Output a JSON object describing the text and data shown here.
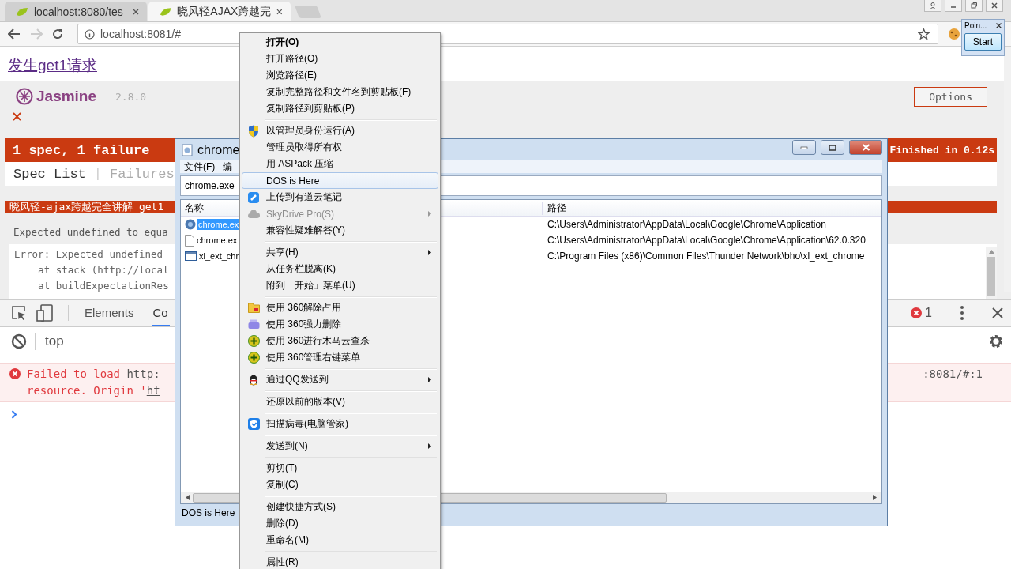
{
  "browser": {
    "tabs": [
      {
        "title": "localhost:8080/tes",
        "selected": false
      },
      {
        "title": "晓风轻AJAX跨越完",
        "selected": true
      }
    ],
    "address": "localhost:8081/#"
  },
  "page": {
    "link": "发生get1请求",
    "jasmine": {
      "logo": "Jasmine",
      "version": "2.8.0",
      "options_button": "Options",
      "summary": "1 spec, 1 failure",
      "duration": "Finished in 0.12s",
      "nav": [
        {
          "label": "Spec List",
          "selected": true
        },
        {
          "label": "Failures",
          "selected": false
        }
      ],
      "nav_separator": "|",
      "spec_title": "晓风轻-ajax跨越完全讲解 get1",
      "message": "Expected undefined to equa",
      "stack": [
        "Error: Expected undefined",
        "    at stack (http://local",
        "    at buildExpectationRes"
      ]
    }
  },
  "devtools": {
    "tabs": [
      {
        "label": "Elements",
        "selected": false
      },
      {
        "label": "Co",
        "selected": true
      }
    ],
    "error_count": "1",
    "context": "top",
    "error": {
      "lines": [
        {
          "text": "Failed to load ",
          "link": "http:"
        },
        {
          "text": "resource. Origin '",
          "link": "ht"
        }
      ],
      "source": ":8081/#:1"
    }
  },
  "explorer": {
    "title": "chrome",
    "menu": [
      "文件(F)",
      "编"
    ],
    "search": "chrome.exe",
    "columns": [
      "名称",
      "路径"
    ],
    "rows": [
      {
        "name": "chrome.ex",
        "path": "C:\\Users\\Administrator\\AppData\\Local\\Google\\Chrome\\Application",
        "selected": true,
        "kind": "app"
      },
      {
        "name": "chrome.ex",
        "path": "C:\\Users\\Administrator\\AppData\\Local\\Google\\Chrome\\Application\\62.0.320",
        "selected": false,
        "kind": "file"
      },
      {
        "name": "xl_ext_chr",
        "path": "C:\\Program Files (x86)\\Common Files\\Thunder Network\\bho\\xl_ext_chrome",
        "selected": false,
        "kind": "window"
      }
    ],
    "status": "DOS is Here"
  },
  "context_menu": {
    "groups": [
      {
        "items": [
          {
            "label": "打开(O)",
            "kind": "none",
            "default": true,
            "highlighted": false,
            "disabled": false,
            "submenu": false
          },
          {
            "label": "打开路径(O)",
            "kind": "none",
            "default": false,
            "highlighted": false,
            "disabled": false,
            "submenu": false
          },
          {
            "label": "浏览路径(E)",
            "kind": "none",
            "default": false,
            "highlighted": false,
            "disabled": false,
            "submenu": false
          },
          {
            "label": "复制完整路径和文件名到剪贴板(F)",
            "kind": "none",
            "default": false,
            "highlighted": false,
            "disabled": false,
            "submenu": false
          },
          {
            "label": "复制路径到剪贴板(P)",
            "kind": "none",
            "default": false,
            "highlighted": false,
            "disabled": false,
            "submenu": false
          }
        ]
      },
      {
        "items": [
          {
            "label": "以管理员身份运行(A)",
            "kind": "uac",
            "default": false,
            "highlighted": false,
            "disabled": false,
            "submenu": false
          },
          {
            "label": "管理员取得所有权",
            "kind": "none",
            "default": false,
            "highlighted": false,
            "disabled": false,
            "submenu": false
          },
          {
            "label": "用 ASPack 压缩",
            "kind": "none",
            "default": false,
            "highlighted": false,
            "disabled": false,
            "submenu": false
          },
          {
            "label": "DOS is Here",
            "kind": "none",
            "default": false,
            "highlighted": true,
            "disabled": false,
            "submenu": false
          },
          {
            "label": "上传到有道云笔记",
            "kind": "note",
            "default": false,
            "highlighted": false,
            "disabled": false,
            "submenu": false
          },
          {
            "label": "SkyDrive Pro(S)",
            "kind": "cloud",
            "default": false,
            "highlighted": false,
            "disabled": true,
            "submenu": true
          },
          {
            "label": "兼容性疑难解答(Y)",
            "kind": "none",
            "default": false,
            "highlighted": false,
            "disabled": false,
            "submenu": false
          }
        ]
      },
      {
        "items": [
          {
            "label": "共享(H)",
            "kind": "none",
            "default": false,
            "highlighted": false,
            "disabled": false,
            "submenu": true
          },
          {
            "label": "从任务栏脱离(K)",
            "kind": "none",
            "default": false,
            "highlighted": false,
            "disabled": false,
            "submenu": false
          },
          {
            "label": "附到「开始」菜单(U)",
            "kind": "none",
            "default": false,
            "highlighted": false,
            "disabled": false,
            "submenu": false
          }
        ]
      },
      {
        "items": [
          {
            "label": "使用 360解除占用",
            "kind": "unlock",
            "default": false,
            "highlighted": false,
            "disabled": false,
            "submenu": false
          },
          {
            "label": "使用 360强力删除",
            "kind": "erase",
            "default": false,
            "highlighted": false,
            "disabled": false,
            "submenu": false
          },
          {
            "label": "使用 360进行木马云查杀",
            "kind": "plus",
            "default": false,
            "highlighted": false,
            "disabled": false,
            "submenu": false
          },
          {
            "label": "使用 360管理右键菜单",
            "kind": "plus",
            "default": false,
            "highlighted": false,
            "disabled": false,
            "submenu": false
          }
        ]
      },
      {
        "items": [
          {
            "label": "通过QQ发送到",
            "kind": "qq",
            "default": false,
            "highlighted": false,
            "disabled": false,
            "submenu": true
          }
        ]
      },
      {
        "items": [
          {
            "label": "还原以前的版本(V)",
            "kind": "none",
            "default": false,
            "highlighted": false,
            "disabled": false,
            "submenu": false
          }
        ]
      },
      {
        "items": [
          {
            "label": "扫描病毒(电脑管家)",
            "kind": "guard",
            "default": false,
            "highlighted": false,
            "disabled": false,
            "submenu": false
          }
        ]
      },
      {
        "items": [
          {
            "label": "发送到(N)",
            "kind": "none",
            "default": false,
            "highlighted": false,
            "disabled": false,
            "submenu": true
          }
        ]
      },
      {
        "items": [
          {
            "label": "剪切(T)",
            "kind": "none",
            "default": false,
            "highlighted": false,
            "disabled": false,
            "submenu": false
          },
          {
            "label": "复制(C)",
            "kind": "none",
            "default": false,
            "highlighted": false,
            "disabled": false,
            "submenu": false
          }
        ]
      },
      {
        "items": [
          {
            "label": "创建快捷方式(S)",
            "kind": "none",
            "default": false,
            "highlighted": false,
            "disabled": false,
            "submenu": false
          },
          {
            "label": "删除(D)",
            "kind": "none",
            "default": false,
            "highlighted": false,
            "disabled": false,
            "submenu": false
          },
          {
            "label": "重命名(M)",
            "kind": "none",
            "default": false,
            "highlighted": false,
            "disabled": false,
            "submenu": false
          }
        ]
      },
      {
        "items": [
          {
            "label": "属性(R)",
            "kind": "none",
            "default": false,
            "highlighted": false,
            "disabled": false,
            "submenu": false
          }
        ]
      }
    ]
  },
  "popup": {
    "title": "Poin...",
    "button": "Start"
  }
}
